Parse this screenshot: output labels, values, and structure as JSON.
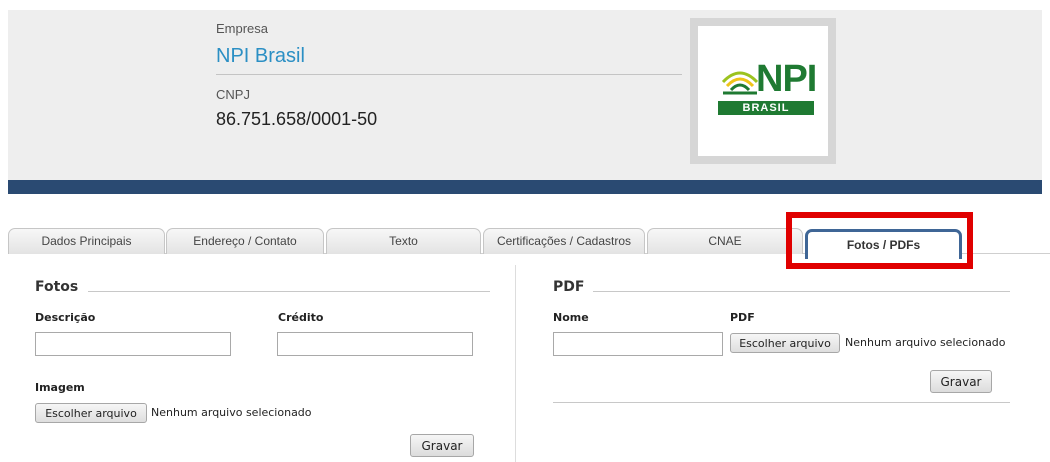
{
  "header": {
    "company_label": "Empresa",
    "company_name": "NPI Brasil",
    "cnpj_label": "CNPJ",
    "cnpj_value": "86.751.658/0001-50",
    "logo": {
      "main_text": "NPI",
      "sub_text": "BRASIL",
      "icon": "sun-rays-logo-icon"
    }
  },
  "colors": {
    "header_bg": "#eeeeee",
    "bar": "#2a4a72",
    "link_blue": "#2b8fc4",
    "highlight": "#e00000",
    "logo_green": "#1f7a32"
  },
  "tabs": [
    {
      "label": "Dados Principais",
      "active": false
    },
    {
      "label": "Endereço / Contato",
      "active": false
    },
    {
      "label": "Texto",
      "active": false
    },
    {
      "label": "Certificações / Cadastros",
      "active": false
    },
    {
      "label": "CNAE",
      "active": false
    },
    {
      "label": "Fotos / PDFs",
      "active": true
    }
  ],
  "fotos": {
    "title": "Fotos",
    "description_label": "Descrição",
    "credit_label": "Crédito",
    "image_label": "Imagem",
    "file_button": "Escolher arquivo",
    "file_status": "Nenhum arquivo selecionado",
    "save_button": "Gravar"
  },
  "pdf": {
    "title": "PDF",
    "name_label": "Nome",
    "pdf_label": "PDF",
    "file_button": "Escolher arquivo",
    "file_status": "Nenhum arquivo selecionado",
    "save_button": "Gravar"
  }
}
